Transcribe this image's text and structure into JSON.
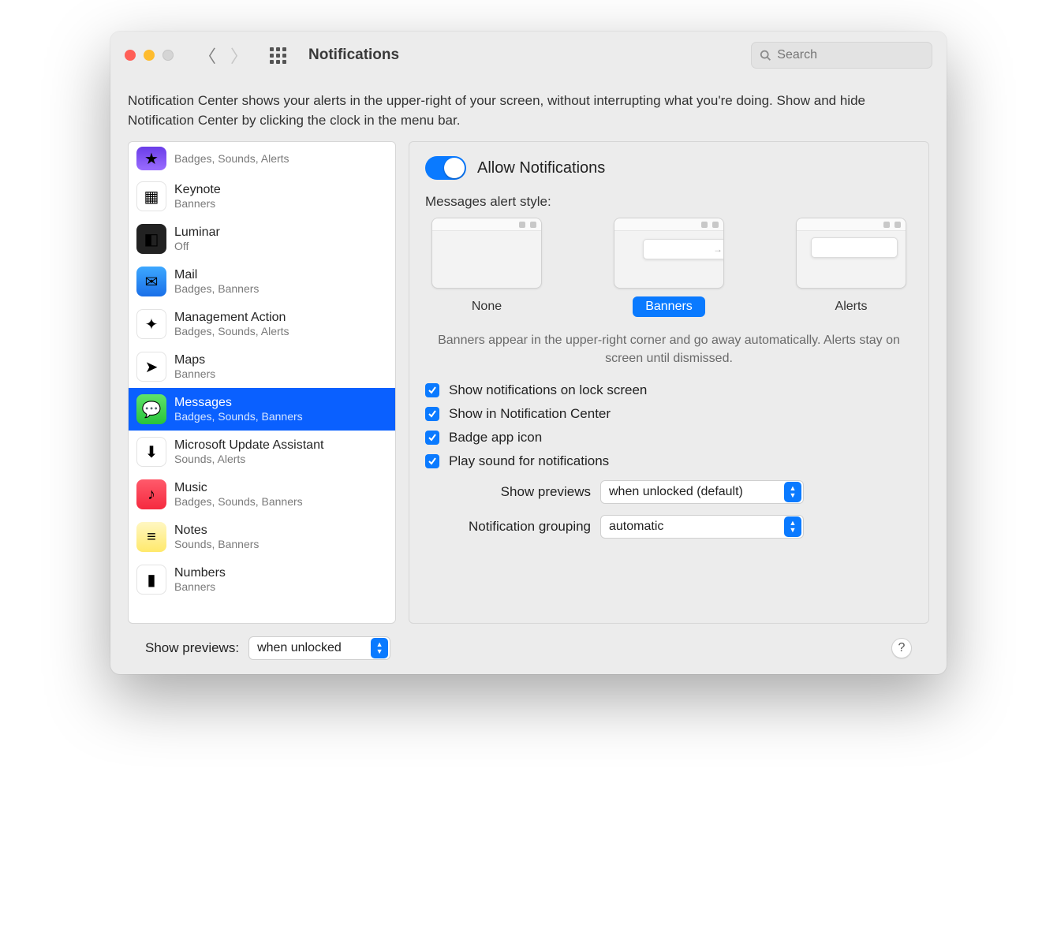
{
  "window": {
    "title": "Notifications",
    "search_placeholder": "Search"
  },
  "intro": "Notification Center shows your alerts in the upper-right of your screen, without interrupting what you're doing. Show and hide Notification Center by clicking the clock in the menu bar.",
  "apps": [
    {
      "name": "",
      "sub": "Badges, Sounds, Alerts",
      "icon": "star-icon",
      "cls": "ic-purple",
      "glyph": "★"
    },
    {
      "name": "Keynote",
      "sub": "Banners",
      "icon": "keynote-icon",
      "cls": "ic-white",
      "glyph": "▦"
    },
    {
      "name": "Luminar",
      "sub": "Off",
      "icon": "luminar-icon",
      "cls": "ic-dark",
      "glyph": "◧"
    },
    {
      "name": "Mail",
      "sub": "Badges, Banners",
      "icon": "mail-icon",
      "cls": "ic-blue",
      "glyph": "✉"
    },
    {
      "name": "Management Action",
      "sub": "Badges, Sounds, Alerts",
      "icon": "management-icon",
      "cls": "ic-multi",
      "glyph": "✦"
    },
    {
      "name": "Maps",
      "sub": "Banners",
      "icon": "maps-icon",
      "cls": "ic-white",
      "glyph": "➤"
    },
    {
      "name": "Messages",
      "sub": "Badges, Sounds, Banners",
      "icon": "messages-icon",
      "cls": "ic-green",
      "glyph": "💬",
      "selected": true
    },
    {
      "name": "Microsoft Update Assistant",
      "sub": "Sounds, Alerts",
      "icon": "msupdate-icon",
      "cls": "ic-white",
      "glyph": "⬇"
    },
    {
      "name": "Music",
      "sub": "Badges, Sounds, Banners",
      "icon": "music-icon",
      "cls": "ic-red",
      "glyph": "♪"
    },
    {
      "name": "Notes",
      "sub": "Sounds, Banners",
      "icon": "notes-icon",
      "cls": "ic-yellow",
      "glyph": "≡"
    },
    {
      "name": "Numbers",
      "sub": "Banners",
      "icon": "numbers-icon",
      "cls": "ic-white",
      "glyph": "▮"
    }
  ],
  "detail": {
    "allow_label": "Allow Notifications",
    "style_heading": "Messages alert style:",
    "styles": {
      "none": "None",
      "banners": "Banners",
      "alerts": "Alerts"
    },
    "style_selected": "banners",
    "style_desc": "Banners appear in the upper-right corner and go away automatically. Alerts stay on screen until dismissed.",
    "checks": {
      "lock": "Show notifications on lock screen",
      "center": "Show in Notification Center",
      "badge": "Badge app icon",
      "sound": "Play sound for notifications"
    },
    "previews_label": "Show previews",
    "previews_value": "when unlocked (default)",
    "grouping_label": "Notification grouping",
    "grouping_value": "automatic"
  },
  "footer": {
    "previews_label": "Show previews:",
    "previews_value": "when unlocked"
  }
}
